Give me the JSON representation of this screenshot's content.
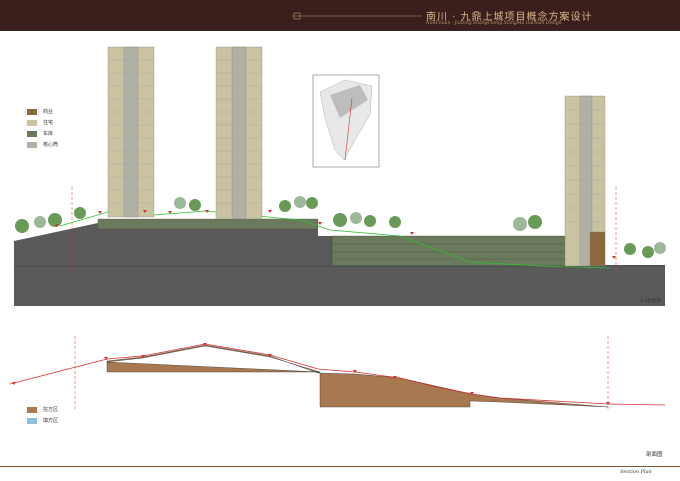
{
  "header": {
    "title": "南川 · 九鼎上城项目概念方案设计",
    "subtitle": "NanChuan · JiuDing ShangCheng XiangMu GaiNian Design"
  },
  "legend_top": [
    {
      "label": "商业",
      "color": "#8b6a3e"
    },
    {
      "label": "住宅",
      "color": "#c9c3a2"
    },
    {
      "label": "车库",
      "color": "#6b7a5c"
    },
    {
      "label": "核心筒",
      "color": "#b0b0a4"
    }
  ],
  "legend_bottom": [
    {
      "label": "挖方区",
      "color": "#a87850"
    },
    {
      "label": "填方区",
      "color": "#8fc0e0"
    }
  ],
  "section_label": "1-1剖面图",
  "footer": {
    "title_cn": "剖面图",
    "title_en": "Section Plan"
  },
  "colors": {
    "header_bg": "#3a1f1c",
    "ground": "#5a5a5a",
    "cut": "#a87850",
    "slope_line": "#d83030",
    "green_line": "#2fbf2f"
  }
}
